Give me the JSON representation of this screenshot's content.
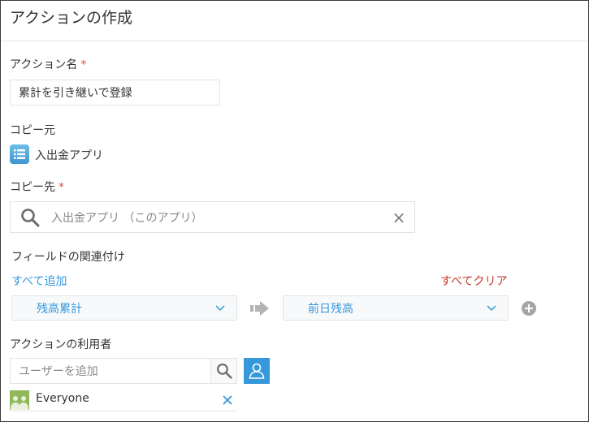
{
  "page": {
    "title": "アクションの作成"
  },
  "action_name": {
    "label": "アクション名",
    "required_mark": "*",
    "value": "累計を引き継いで登録"
  },
  "copy_source": {
    "label": "コピー元",
    "app_name": "入出金アプリ",
    "icon": "list-app-icon"
  },
  "copy_destination": {
    "label": "コピー先",
    "required_mark": "*",
    "placeholder": "入出金アプリ （このアプリ）",
    "clear_glyph": "×"
  },
  "field_mapping": {
    "label": "フィールドの関連付け",
    "add_all": "すべて追加",
    "clear_all": "すべてクリア",
    "source_field": "残高累計",
    "dest_field": "前日残高"
  },
  "action_users": {
    "label": "アクションの利用者",
    "placeholder": "ユーザーを追加",
    "entries": [
      {
        "name": "Everyone"
      }
    ]
  },
  "colors": {
    "accent": "#3498db",
    "required": "#e74c3c",
    "clear_link": "#c0392b"
  }
}
